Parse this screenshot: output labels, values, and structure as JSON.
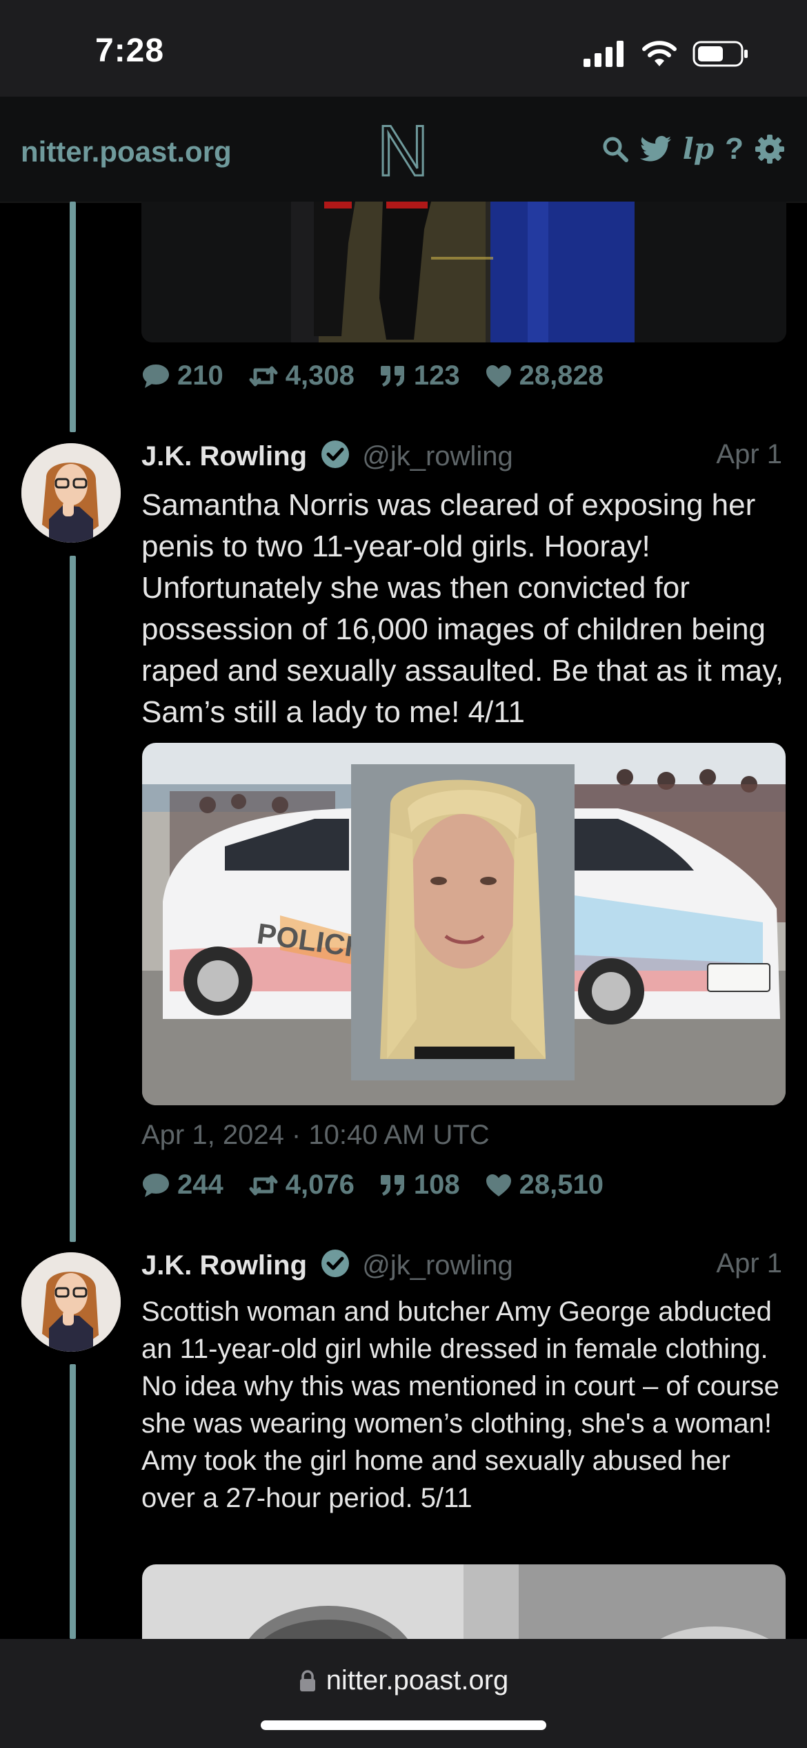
{
  "status_bar": {
    "time": "7:28"
  },
  "nav": {
    "domain": "nitter.poast.org",
    "logo_letter": "N",
    "lp_label": "lp",
    "help_label": "?"
  },
  "thread": [
    {
      "stats": {
        "replies": "210",
        "retweets": "4,308",
        "quotes": "123",
        "likes": "28,828"
      }
    },
    {
      "author": "J.K. Rowling",
      "handle": "@jk_rowling",
      "date": "Apr 1",
      "text": "Samantha Norris was cleared of exposing her penis to two 11-year-old girls. Hooray! Unfortunately she was then convicted for possession of 16,000 images of children being raped and sexually assaulted. Be that as it may, Sam’s still a lady to me! 4/11",
      "image_car_text": "POLICING PR",
      "timestamp": "Apr 1, 2024 · 10:40 AM UTC",
      "stats": {
        "replies": "244",
        "retweets": "4,076",
        "quotes": "108",
        "likes": "28,510"
      }
    },
    {
      "author": "J.K. Rowling",
      "handle": "@jk_rowling",
      "date": "Apr 1",
      "text": "Scottish woman and butcher Amy George abducted an 11-year-old girl while dressed in female clothing. No idea why this was mentioned in court – of course she was wearing women’s clothing, she's a woman! Amy took the girl home and sexually abused her over a 27-hour period. 5/11"
    }
  ],
  "browser": {
    "url": "nitter.poast.org"
  },
  "colors": {
    "accent": "#6f9a9c",
    "background": "#000000",
    "muted": "#5e6568"
  }
}
